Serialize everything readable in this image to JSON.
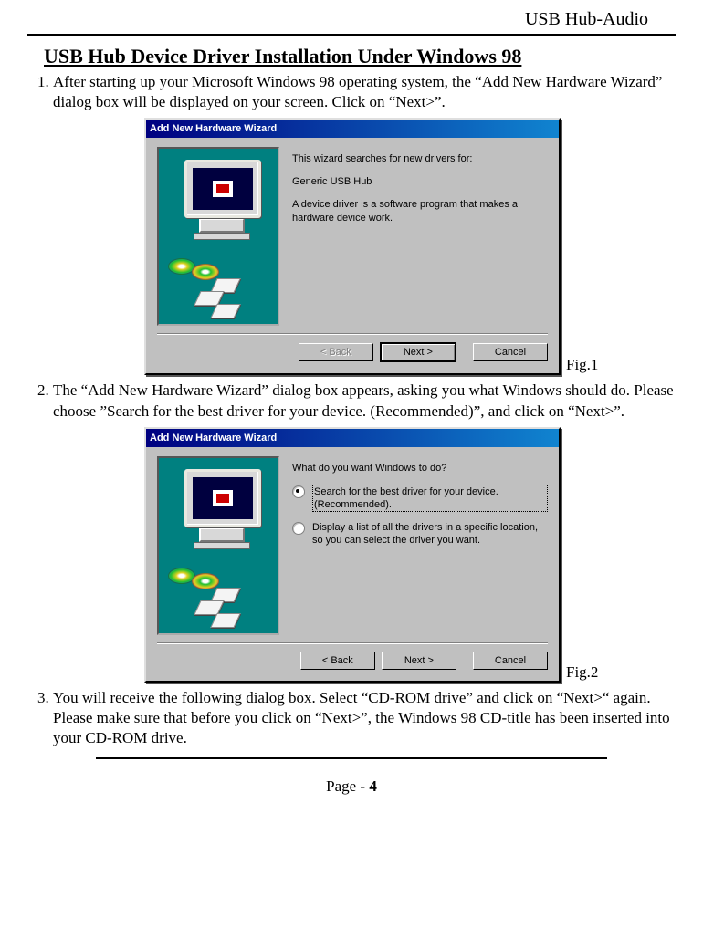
{
  "header": {
    "doc_title": "USB Hub-Audio"
  },
  "section_title": "USB Hub Device Driver Installation Under Windows  98",
  "steps": [
    "After starting up your Microsoft  Windows  98 operating system, the “Add New Hardware Wizard” dialog box will be displayed on your screen. Click on “Next>”.",
    "The “Add New Hardware Wizard” dialog box appears, asking you what Windows should do. Please choose ”Search for the best driver for your device. (Recommended)”, and click on “Next>”.",
    "You will receive the following dialog box. Select “CD-ROM drive” and click on “Next>“ again. Please make sure that before you click on “Next>”, the Windows 98 CD-title has been inserted into your CD-ROM drive."
  ],
  "fig_labels": {
    "fig1": "Fig.1",
    "fig2": "Fig.2"
  },
  "dialog1": {
    "title": "Add New Hardware Wizard",
    "line1": "This wizard searches for new drivers for:",
    "device": "Generic USB Hub",
    "line2": "A device driver is a software program that makes a hardware device work.",
    "back": "< Back",
    "next": "Next >",
    "cancel": "Cancel"
  },
  "dialog2": {
    "title": "Add New Hardware Wizard",
    "prompt": "What do you want Windows to do?",
    "opt1": "Search for the best driver for your device. (Recommended).",
    "opt2": "Display a list of all the drivers in a specific location, so you can select the driver you want.",
    "back": "< Back",
    "next": "Next >",
    "cancel": "Cancel"
  },
  "step3_cd_text": "C",
  "step3_rest": "D-ROM drive",
  "footer": {
    "prefix": "Page - ",
    "num": "4"
  }
}
